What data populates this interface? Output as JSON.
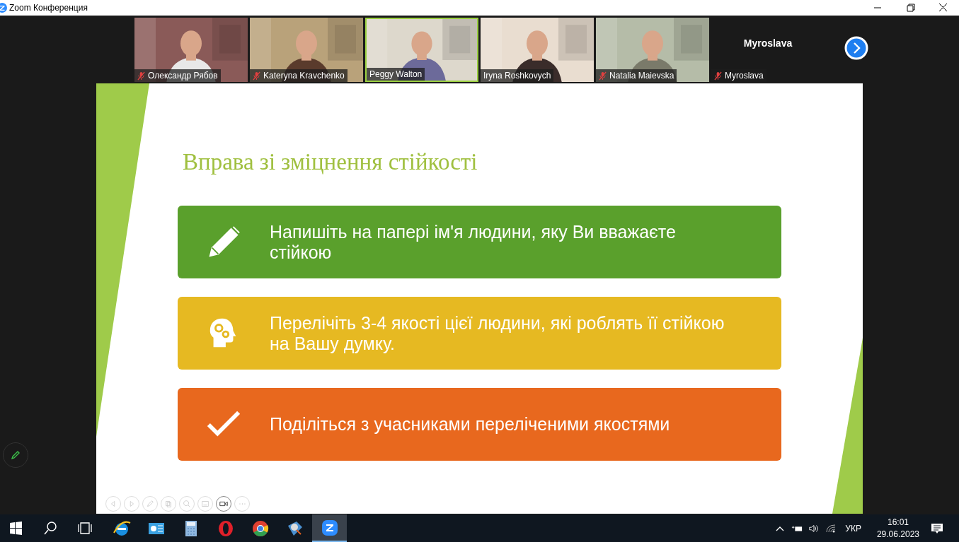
{
  "window": {
    "title": "Zoom Конференция"
  },
  "participants": [
    {
      "name": "Олександр Рябов",
      "kind": "video",
      "muted": true,
      "active_speaker": false
    },
    {
      "name": "Kateryna Kravchenko",
      "kind": "video",
      "muted": true,
      "active_speaker": false
    },
    {
      "name": "Peggy Walton",
      "kind": "video",
      "muted": false,
      "active_speaker": true
    },
    {
      "name": "Iryna Roshkovych",
      "kind": "video",
      "muted": false,
      "active_speaker": false
    },
    {
      "name": "Natalia Maievska",
      "kind": "video",
      "muted": true,
      "active_speaker": false
    },
    {
      "name": "Myroslava",
      "kind": "name_only",
      "muted": true,
      "active_speaker": false,
      "big_name": "Myroslava"
    }
  ],
  "slide": {
    "title": "Вправа зі зміцнення стійкості",
    "items": [
      {
        "color": "#5aa02c",
        "text": "Напишіть на папері ім'я людини, яку Ви вважаєте стійкою"
      },
      {
        "color": "#e6b922",
        "text": "Перелічіть 3-4 якості цієї людини, які роблять її стійкою на Вашу думку."
      },
      {
        "color": "#e8681e",
        "text": "Поділіться з учасниками переліченими якостями"
      }
    ]
  },
  "slide_controls": [
    {
      "selected": false
    },
    {
      "selected": false
    },
    {
      "selected": false
    },
    {
      "selected": false
    },
    {
      "selected": false
    },
    {
      "selected": false
    },
    {
      "selected": true
    },
    {
      "selected": false
    }
  ],
  "taskbar": {
    "apps": [
      {
        "selected": false
      },
      {
        "selected": false
      },
      {
        "selected": false
      },
      {
        "selected": false
      },
      {
        "selected": false
      },
      {
        "selected": false
      },
      {
        "selected": true
      }
    ],
    "language": "УКР",
    "time": "16:01",
    "date": "29.06.2023"
  }
}
